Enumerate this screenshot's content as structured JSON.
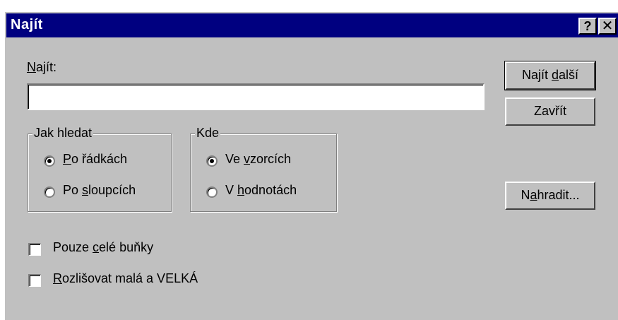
{
  "window": {
    "title": "Najít",
    "help_label": "?",
    "close_label": "✕"
  },
  "find": {
    "label_prefix": "",
    "label_accel": "N",
    "label_rest": "ajít:",
    "value": "",
    "placeholder": ""
  },
  "buttons": {
    "find_next": {
      "prefix": "Najít ",
      "accel": "d",
      "rest": "alší"
    },
    "close": {
      "prefix": "",
      "accel": "",
      "rest": "Zavřít"
    },
    "replace": {
      "prefix": "N",
      "accel": "a",
      "rest": "hradit..."
    }
  },
  "search_direction": {
    "legend": "Jak hledat",
    "options": [
      {
        "prefix": "",
        "accel": "P",
        "rest": "o řádkách",
        "checked": true
      },
      {
        "prefix": "Po ",
        "accel": "s",
        "rest": "loupcích",
        "checked": false
      }
    ]
  },
  "look_in": {
    "legend": "Kde",
    "options": [
      {
        "prefix": "Ve ",
        "accel": "v",
        "rest": "zorcích",
        "checked": true
      },
      {
        "prefix": "V ",
        "accel": "h",
        "rest": "odnotách",
        "checked": false
      }
    ]
  },
  "checkboxes": [
    {
      "prefix": "Pouze ",
      "accel": "c",
      "rest": "elé buňky",
      "checked": false
    },
    {
      "prefix": "",
      "accel": "R",
      "rest": "ozlišovat malá a VELKÁ",
      "checked": false
    }
  ]
}
